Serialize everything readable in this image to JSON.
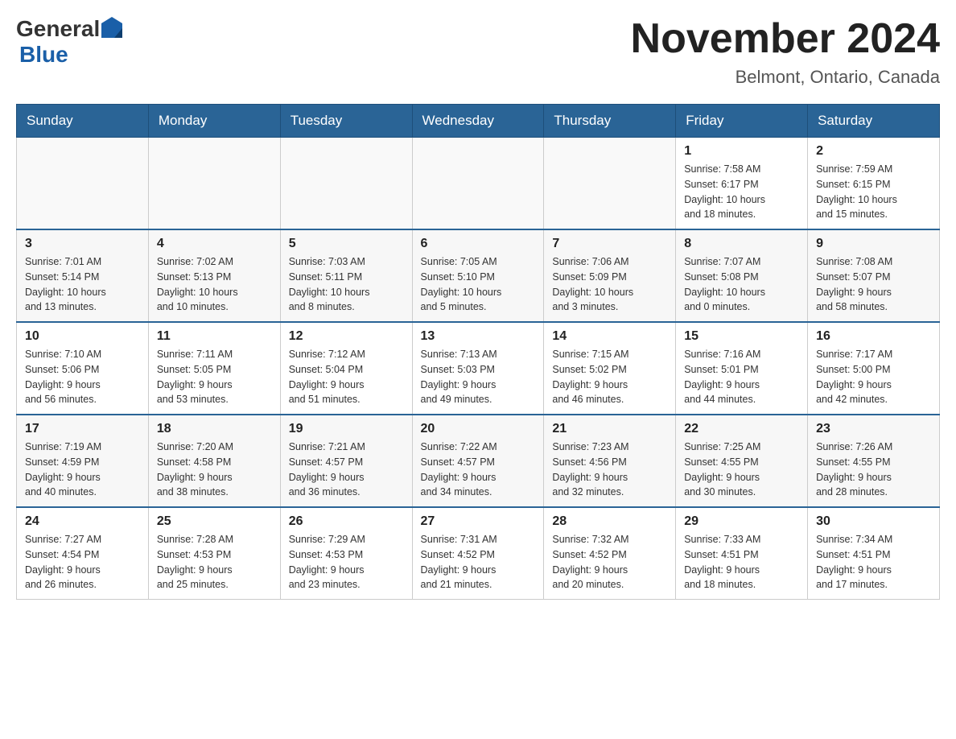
{
  "header": {
    "logo_general": "General",
    "logo_blue": "Blue",
    "title": "November 2024",
    "subtitle": "Belmont, Ontario, Canada"
  },
  "days_of_week": [
    "Sunday",
    "Monday",
    "Tuesday",
    "Wednesday",
    "Thursday",
    "Friday",
    "Saturday"
  ],
  "weeks": [
    {
      "days": [
        {
          "number": "",
          "info": ""
        },
        {
          "number": "",
          "info": ""
        },
        {
          "number": "",
          "info": ""
        },
        {
          "number": "",
          "info": ""
        },
        {
          "number": "",
          "info": ""
        },
        {
          "number": "1",
          "info": "Sunrise: 7:58 AM\nSunset: 6:17 PM\nDaylight: 10 hours\nand 18 minutes."
        },
        {
          "number": "2",
          "info": "Sunrise: 7:59 AM\nSunset: 6:15 PM\nDaylight: 10 hours\nand 15 minutes."
        }
      ]
    },
    {
      "days": [
        {
          "number": "3",
          "info": "Sunrise: 7:01 AM\nSunset: 5:14 PM\nDaylight: 10 hours\nand 13 minutes."
        },
        {
          "number": "4",
          "info": "Sunrise: 7:02 AM\nSunset: 5:13 PM\nDaylight: 10 hours\nand 10 minutes."
        },
        {
          "number": "5",
          "info": "Sunrise: 7:03 AM\nSunset: 5:11 PM\nDaylight: 10 hours\nand 8 minutes."
        },
        {
          "number": "6",
          "info": "Sunrise: 7:05 AM\nSunset: 5:10 PM\nDaylight: 10 hours\nand 5 minutes."
        },
        {
          "number": "7",
          "info": "Sunrise: 7:06 AM\nSunset: 5:09 PM\nDaylight: 10 hours\nand 3 minutes."
        },
        {
          "number": "8",
          "info": "Sunrise: 7:07 AM\nSunset: 5:08 PM\nDaylight: 10 hours\nand 0 minutes."
        },
        {
          "number": "9",
          "info": "Sunrise: 7:08 AM\nSunset: 5:07 PM\nDaylight: 9 hours\nand 58 minutes."
        }
      ]
    },
    {
      "days": [
        {
          "number": "10",
          "info": "Sunrise: 7:10 AM\nSunset: 5:06 PM\nDaylight: 9 hours\nand 56 minutes."
        },
        {
          "number": "11",
          "info": "Sunrise: 7:11 AM\nSunset: 5:05 PM\nDaylight: 9 hours\nand 53 minutes."
        },
        {
          "number": "12",
          "info": "Sunrise: 7:12 AM\nSunset: 5:04 PM\nDaylight: 9 hours\nand 51 minutes."
        },
        {
          "number": "13",
          "info": "Sunrise: 7:13 AM\nSunset: 5:03 PM\nDaylight: 9 hours\nand 49 minutes."
        },
        {
          "number": "14",
          "info": "Sunrise: 7:15 AM\nSunset: 5:02 PM\nDaylight: 9 hours\nand 46 minutes."
        },
        {
          "number": "15",
          "info": "Sunrise: 7:16 AM\nSunset: 5:01 PM\nDaylight: 9 hours\nand 44 minutes."
        },
        {
          "number": "16",
          "info": "Sunrise: 7:17 AM\nSunset: 5:00 PM\nDaylight: 9 hours\nand 42 minutes."
        }
      ]
    },
    {
      "days": [
        {
          "number": "17",
          "info": "Sunrise: 7:19 AM\nSunset: 4:59 PM\nDaylight: 9 hours\nand 40 minutes."
        },
        {
          "number": "18",
          "info": "Sunrise: 7:20 AM\nSunset: 4:58 PM\nDaylight: 9 hours\nand 38 minutes."
        },
        {
          "number": "19",
          "info": "Sunrise: 7:21 AM\nSunset: 4:57 PM\nDaylight: 9 hours\nand 36 minutes."
        },
        {
          "number": "20",
          "info": "Sunrise: 7:22 AM\nSunset: 4:57 PM\nDaylight: 9 hours\nand 34 minutes."
        },
        {
          "number": "21",
          "info": "Sunrise: 7:23 AM\nSunset: 4:56 PM\nDaylight: 9 hours\nand 32 minutes."
        },
        {
          "number": "22",
          "info": "Sunrise: 7:25 AM\nSunset: 4:55 PM\nDaylight: 9 hours\nand 30 minutes."
        },
        {
          "number": "23",
          "info": "Sunrise: 7:26 AM\nSunset: 4:55 PM\nDaylight: 9 hours\nand 28 minutes."
        }
      ]
    },
    {
      "days": [
        {
          "number": "24",
          "info": "Sunrise: 7:27 AM\nSunset: 4:54 PM\nDaylight: 9 hours\nand 26 minutes."
        },
        {
          "number": "25",
          "info": "Sunrise: 7:28 AM\nSunset: 4:53 PM\nDaylight: 9 hours\nand 25 minutes."
        },
        {
          "number": "26",
          "info": "Sunrise: 7:29 AM\nSunset: 4:53 PM\nDaylight: 9 hours\nand 23 minutes."
        },
        {
          "number": "27",
          "info": "Sunrise: 7:31 AM\nSunset: 4:52 PM\nDaylight: 9 hours\nand 21 minutes."
        },
        {
          "number": "28",
          "info": "Sunrise: 7:32 AM\nSunset: 4:52 PM\nDaylight: 9 hours\nand 20 minutes."
        },
        {
          "number": "29",
          "info": "Sunrise: 7:33 AM\nSunset: 4:51 PM\nDaylight: 9 hours\nand 18 minutes."
        },
        {
          "number": "30",
          "info": "Sunrise: 7:34 AM\nSunset: 4:51 PM\nDaylight: 9 hours\nand 17 minutes."
        }
      ]
    }
  ]
}
